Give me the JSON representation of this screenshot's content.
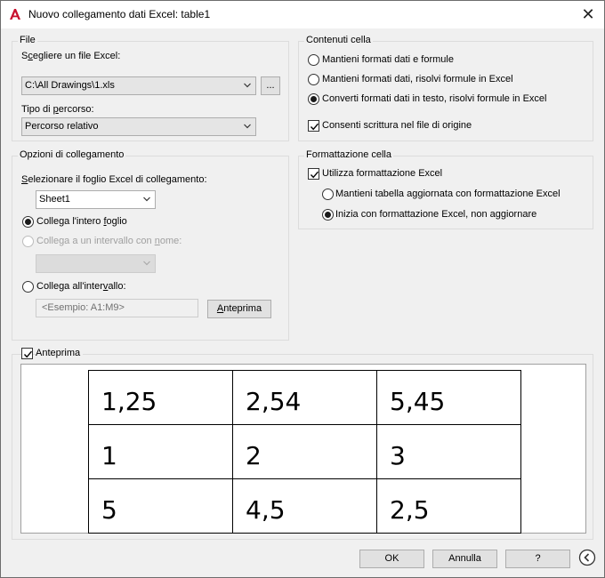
{
  "window": {
    "title": "Nuovo collegamento dati Excel: table1",
    "close_glyph": "✕",
    "app_icon": "autocad-a-icon"
  },
  "file_group": {
    "legend": "File",
    "choose_label": "Scegliere un file Excel:",
    "file_value": "C:\\All Drawings\\1.xls",
    "browse_label": "...",
    "path_type_label": "Tipo di percorso:",
    "path_type_value": "Percorso relativo"
  },
  "cell_contents": {
    "legend": "Contenuti cella",
    "options": [
      "Mantieni formati dati e formule",
      "Mantieni formati dati, risolvi formule in Excel",
      "Converti formati dati in testo, risolvi formule in Excel"
    ],
    "selected_index": 2,
    "allow_write_label": "Consenti scrittura nel file di origine",
    "allow_write_checked": true
  },
  "link_options": {
    "legend": "Opzioni di collegamento",
    "select_sheet_label": "Selezionare il foglio Excel di collegamento:",
    "sheet_value": "Sheet1",
    "radio_entire_sheet": "Collega l'intero foglio",
    "radio_named_range": "Collega a un intervallo con nome:",
    "radio_range": "Collega all'intervallo:",
    "selected": "entire_sheet",
    "range_placeholder": "<Esempio: A1:M9>",
    "preview_button": "Anteprima"
  },
  "cell_formatting": {
    "legend": "Formattazione cella",
    "use_excel_format_label": "Utilizza formattazione Excel",
    "use_excel_format_checked": true,
    "radio_keep_updated": "Mantieni tabella aggiornata con formattazione Excel",
    "radio_start_with": "Inizia con formattazione Excel, non aggiornare",
    "selected": "start_with"
  },
  "preview": {
    "label": "Anteprima",
    "checked": true,
    "table": [
      [
        "1,25",
        "2,54",
        "5,45"
      ],
      [
        "1",
        "2",
        "3"
      ],
      [
        "5",
        "4,5",
        "2,5"
      ]
    ]
  },
  "footer": {
    "ok": "OK",
    "cancel": "Annulla",
    "help": "?",
    "collapse_icon": "chevron-left-circle-icon"
  },
  "colors": {
    "autocad_red": "#c8102e",
    "dialog_bg": "#f0f0f0"
  }
}
